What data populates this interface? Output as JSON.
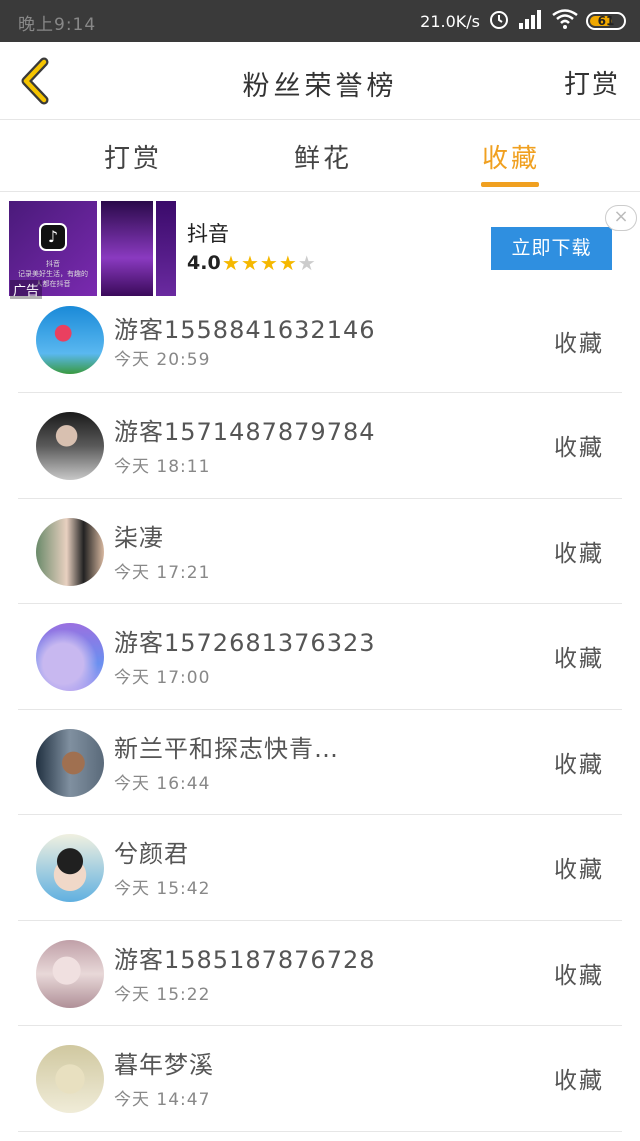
{
  "status_bar": {
    "time": "晚上9:14",
    "net_speed": "21.0K/s",
    "battery": "61"
  },
  "header": {
    "title": "粉丝荣誉榜",
    "right_action": "打赏"
  },
  "tabs": [
    {
      "label": "打赏",
      "active": false
    },
    {
      "label": "鲜花",
      "active": false
    },
    {
      "label": "收藏",
      "active": true
    }
  ],
  "accent_color": "#f0a020",
  "ad": {
    "app_name": "抖音",
    "rating": "4.0",
    "stars_filled": 4,
    "stars_total": 5,
    "ad_tag": "广告",
    "thumb_app": "抖音",
    "thumb_caption": "记录美好生活，有趣的人都在抖音",
    "download_label": "立即下载",
    "close_icon": "close-icon",
    "button_color": "#2f8fe0"
  },
  "fans": [
    {
      "name": "游客1558841632146",
      "time": "今天 20:59",
      "action": "收藏"
    },
    {
      "name": "游客1571487879784",
      "time": "今天 18:11",
      "action": "收藏"
    },
    {
      "name": "柒凄",
      "time": "今天 17:21",
      "action": "收藏"
    },
    {
      "name": "游客1572681376323",
      "time": "今天 17:00",
      "action": "收藏"
    },
    {
      "name": "新兰平和探志快青…",
      "time": "今天 16:44",
      "action": "收藏"
    },
    {
      "name": "兮颜君",
      "time": "今天 15:42",
      "action": "收藏"
    },
    {
      "name": "游客1585187876728",
      "time": "今天 15:22",
      "action": "收藏"
    },
    {
      "name": "暮年梦溪",
      "time": "今天 14:47",
      "action": "收藏"
    }
  ]
}
